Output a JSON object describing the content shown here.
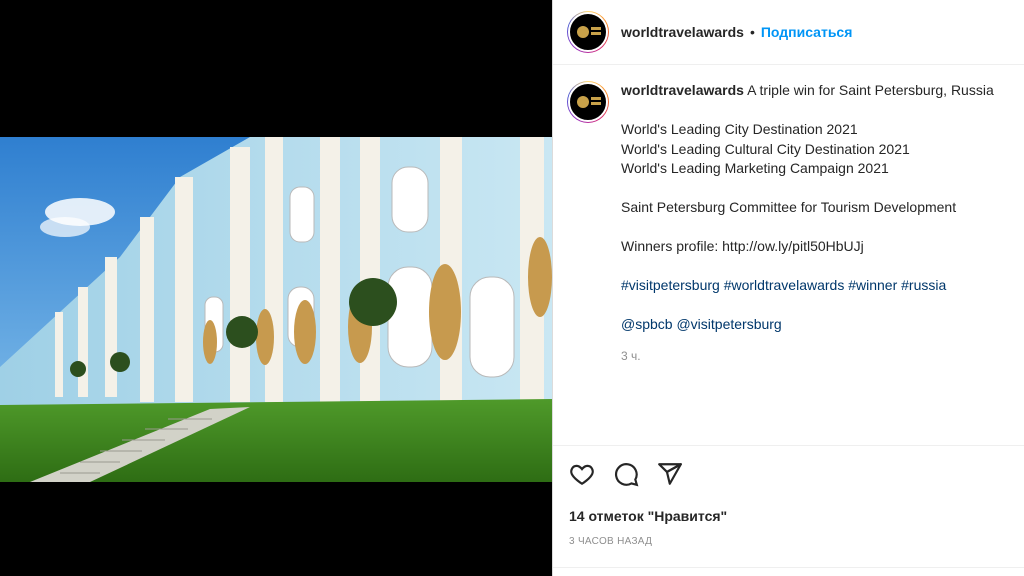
{
  "post": {
    "username": "worldtravelawards",
    "separator": "•",
    "follow_label": "Подписаться"
  },
  "caption": {
    "username": "worldtravelawards",
    "first_line": "A triple win for Saint Petersburg, Russia",
    "awards": [
      "World's Leading City Destination 2021",
      "World's Leading Cultural City Destination 2021",
      "World's Leading Marketing Campaign 2021"
    ],
    "committee": "Saint Petersburg Committee for Tourism Development",
    "winners_profile": "Winners profile: http://ow.ly/pitl50HbUJj",
    "hashtags": "#visitpetersburg #worldtravelawards #winner #russia",
    "mentions": "@spbcb @visitpetersburg",
    "time": "3 ч."
  },
  "actions": {
    "icons": [
      "heart-icon",
      "comment-icon",
      "share-icon"
    ]
  },
  "likes": "14 отметок \"Нравится\"",
  "posted_ago": "3 часов назад"
}
